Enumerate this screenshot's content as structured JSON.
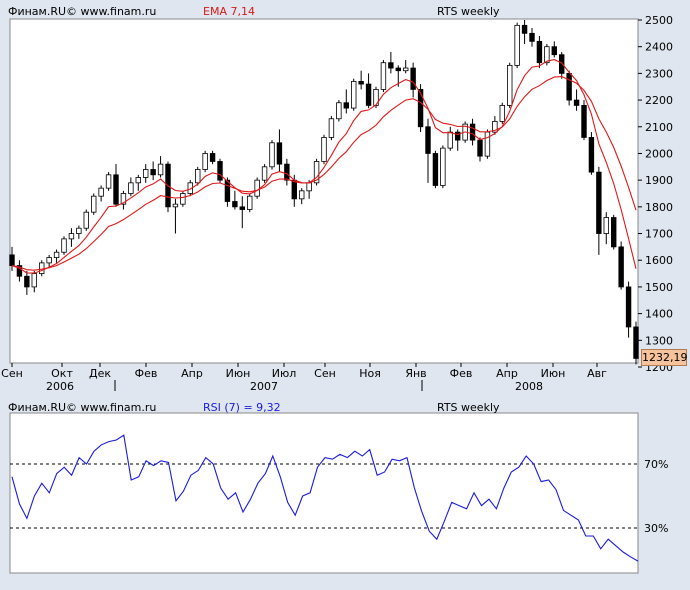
{
  "top_panel": {
    "source": "Финам.RU© www.finam.ru",
    "indicator": "EMA 7,14",
    "title": "RTS weekly",
    "last_price": "1232,19",
    "y_ticks": [
      "2500",
      "2400",
      "2300",
      "2200",
      "2100",
      "2000",
      "1900",
      "1800",
      "1700",
      "1600",
      "1500",
      "1400",
      "1300",
      "1200"
    ],
    "x_months": [
      "Сен",
      "Окт",
      "Дек",
      "Фев",
      "Апр",
      "Июн",
      "Июл",
      "Сен",
      "Ноя",
      "Янв",
      "Фев",
      "Апр",
      "Июн",
      "Авг"
    ],
    "x_years": [
      "2006",
      "2007",
      "2008"
    ]
  },
  "bottom_panel": {
    "source": "Финам.RU© www.finam.ru",
    "indicator": "RSI (7) = 9,32",
    "title": "RTS weekly",
    "level_70": "70%",
    "level_30": "30%"
  },
  "chart_data": [
    {
      "type": "candlestick",
      "title": "RTS weekly",
      "indicator": "EMA 7,14",
      "ylim": [
        1200,
        2500
      ],
      "colors": {
        "up": "#ffffff",
        "down": "#000000",
        "ema": "#e01818"
      },
      "ohlc": [
        [
          1620,
          1650,
          1560,
          1580
        ],
        [
          1580,
          1600,
          1520,
          1540
        ],
        [
          1540,
          1560,
          1470,
          1500
        ],
        [
          1500,
          1560,
          1480,
          1550
        ],
        [
          1550,
          1600,
          1540,
          1590
        ],
        [
          1590,
          1620,
          1570,
          1610
        ],
        [
          1610,
          1640,
          1590,
          1630
        ],
        [
          1630,
          1690,
          1620,
          1680
        ],
        [
          1680,
          1720,
          1650,
          1700
        ],
        [
          1700,
          1730,
          1680,
          1720
        ],
        [
          1720,
          1790,
          1710,
          1780
        ],
        [
          1780,
          1850,
          1770,
          1840
        ],
        [
          1840,
          1880,
          1820,
          1870
        ],
        [
          1870,
          1930,
          1860,
          1920
        ],
        [
          1920,
          1960,
          1800,
          1810
        ],
        [
          1810,
          1860,
          1790,
          1850
        ],
        [
          1850,
          1910,
          1840,
          1890
        ],
        [
          1890,
          1920,
          1860,
          1910
        ],
        [
          1910,
          1960,
          1890,
          1940
        ],
        [
          1940,
          1970,
          1900,
          1920
        ],
        [
          1920,
          1990,
          1910,
          1960
        ],
        [
          1960,
          1970,
          1780,
          1800
        ],
        [
          1800,
          1830,
          1700,
          1810
        ],
        [
          1810,
          1860,
          1800,
          1850
        ],
        [
          1850,
          1900,
          1840,
          1890
        ],
        [
          1890,
          1950,
          1880,
          1940
        ],
        [
          1940,
          2010,
          1930,
          2000
        ],
        [
          2000,
          2010,
          1960,
          1970
        ],
        [
          1970,
          1980,
          1890,
          1900
        ],
        [
          1900,
          1910,
          1800,
          1820
        ],
        [
          1820,
          1860,
          1790,
          1800
        ],
        [
          1800,
          1840,
          1720,
          1790
        ],
        [
          1790,
          1850,
          1780,
          1840
        ],
        [
          1840,
          1910,
          1830,
          1900
        ],
        [
          1900,
          1960,
          1890,
          1950
        ],
        [
          1950,
          2050,
          1940,
          2040
        ],
        [
          2040,
          2090,
          1930,
          1960
        ],
        [
          1960,
          1980,
          1880,
          1900
        ],
        [
          1900,
          1920,
          1800,
          1830
        ],
        [
          1830,
          1870,
          1810,
          1860
        ],
        [
          1860,
          1900,
          1830,
          1890
        ],
        [
          1890,
          1980,
          1880,
          1970
        ],
        [
          1970,
          2070,
          1960,
          2060
        ],
        [
          2060,
          2140,
          2050,
          2130
        ],
        [
          2130,
          2200,
          2120,
          2190
        ],
        [
          2190,
          2240,
          2150,
          2170
        ],
        [
          2170,
          2280,
          2160,
          2270
        ],
        [
          2270,
          2310,
          2240,
          2260
        ],
        [
          2260,
          2300,
          2170,
          2180
        ],
        [
          2180,
          2250,
          2170,
          2240
        ],
        [
          2240,
          2350,
          2230,
          2340
        ],
        [
          2340,
          2380,
          2300,
          2320
        ],
        [
          2320,
          2330,
          2250,
          2310
        ],
        [
          2310,
          2350,
          2300,
          2320
        ],
        [
          2320,
          2340,
          2210,
          2240
        ],
        [
          2240,
          2260,
          2080,
          2100
        ],
        [
          2100,
          2130,
          1890,
          2000
        ],
        [
          2000,
          2010,
          1870,
          1880
        ],
        [
          1880,
          2030,
          1870,
          2020
        ],
        [
          2020,
          2100,
          2010,
          2080
        ],
        [
          2080,
          2090,
          2010,
          2050
        ],
        [
          2050,
          2120,
          2040,
          2110
        ],
        [
          2110,
          2130,
          2030,
          2050
        ],
        [
          2050,
          2060,
          1970,
          1990
        ],
        [
          1990,
          2090,
          1980,
          2080
        ],
        [
          2080,
          2140,
          2070,
          2120
        ],
        [
          2120,
          2190,
          2110,
          2180
        ],
        [
          2180,
          2340,
          2170,
          2330
        ],
        [
          2330,
          2490,
          2320,
          2480
        ],
        [
          2480,
          2500,
          2410,
          2450
        ],
        [
          2450,
          2470,
          2400,
          2420
        ],
        [
          2420,
          2440,
          2320,
          2340
        ],
        [
          2340,
          2410,
          2330,
          2400
        ],
        [
          2400,
          2420,
          2360,
          2370
        ],
        [
          2370,
          2380,
          2280,
          2300
        ],
        [
          2300,
          2310,
          2180,
          2200
        ],
        [
          2200,
          2240,
          2160,
          2180
        ],
        [
          2180,
          2200,
          2050,
          2060
        ],
        [
          2060,
          2080,
          1920,
          1930
        ],
        [
          1930,
          1950,
          1620,
          1700
        ],
        [
          1700,
          1780,
          1660,
          1760
        ],
        [
          1760,
          1770,
          1640,
          1650
        ],
        [
          1650,
          1670,
          1490,
          1500
        ],
        [
          1500,
          1520,
          1310,
          1350
        ],
        [
          1350,
          1370,
          1210,
          1232.19
        ]
      ]
    },
    {
      "type": "line",
      "title": "RTS weekly",
      "indicator": "RSI (7) = 9,32",
      "ylim": [
        0,
        100
      ],
      "levels": [
        70,
        30
      ],
      "colors": {
        "line": "#1a1adf",
        "level": "#000000"
      },
      "values": [
        62,
        45,
        36,
        50,
        58,
        52,
        64,
        68,
        63,
        74,
        70,
        78,
        82,
        84,
        85,
        88,
        60,
        62,
        72,
        69,
        72,
        71,
        47,
        53,
        63,
        66,
        74,
        70,
        55,
        48,
        52,
        40,
        48,
        58,
        64,
        75,
        62,
        46,
        38,
        50,
        52,
        68,
        74,
        73,
        76,
        74,
        78,
        75,
        79,
        63,
        65,
        73,
        72,
        74,
        55,
        40,
        28,
        23,
        34,
        46,
        44,
        42,
        52,
        44,
        48,
        42,
        55,
        65,
        68,
        75,
        70,
        59,
        60,
        54,
        41,
        38,
        35,
        25,
        25,
        17,
        23,
        19,
        15,
        12,
        9.32
      ]
    }
  ]
}
